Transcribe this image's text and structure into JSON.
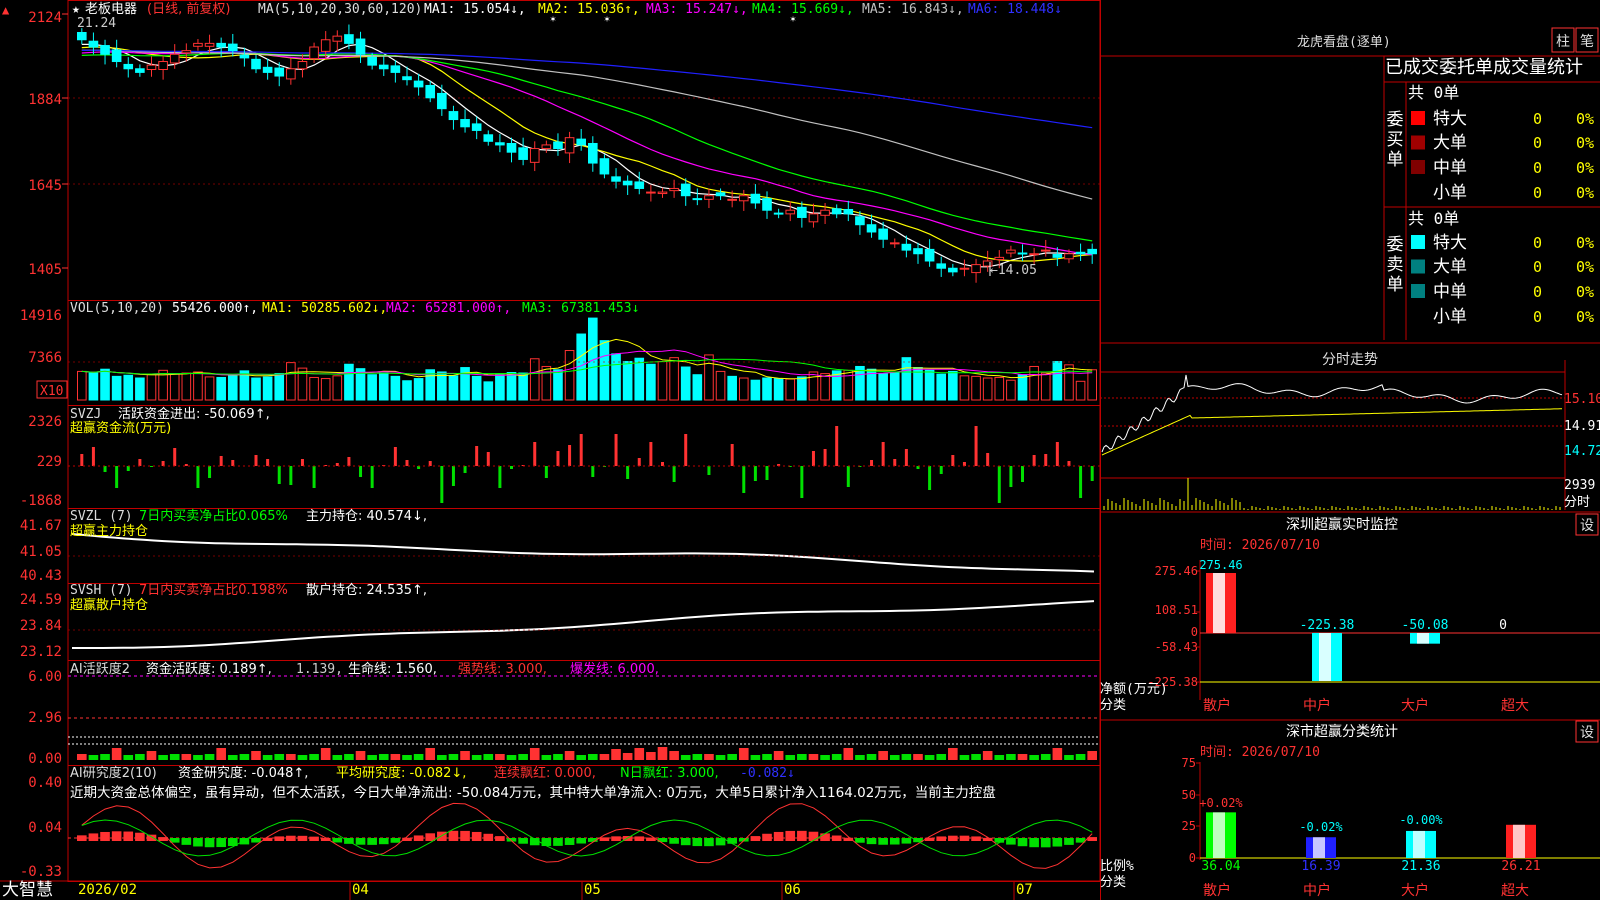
{
  "app": {
    "brand": "大智慧",
    "chip": "▲"
  },
  "colors": {
    "up": "#ff3232",
    "down": "#00ffff",
    "grid": "#c00000",
    "axis": "#ff3232",
    "ma1": "#ffffff",
    "ma2": "#ffff00",
    "ma3": "#ff00ff",
    "ma4": "#00ff00",
    "ma5": "#c0c0c0",
    "ma6": "#2020ff"
  },
  "price_header": {
    "star": "★",
    "name": "老板电器",
    "mode": "(日线, 前复权)",
    "ma_def": "MA(5,10,20,30,60,120)",
    "ma1": "MA1: 15.054↓,",
    "ma2": "MA2: 15.036↑,",
    "ma3": "MA3: 15.247↓,",
    "ma4": "MA4: 15.669↓,",
    "ma5": "MA5: 16.843↓,",
    "ma6": "MA6: 18.448↓",
    "hi_label": "21.24",
    "lo_label": "←14.05"
  },
  "vol_header": {
    "title": "VOL(5,10,20)",
    "value": "55426.000↑,",
    "ma1": "MA1: 50285.602↓,",
    "ma2": "MA2: 65281.000↑,",
    "ma3": "MA3: 67381.453↓",
    "unit": "X10"
  },
  "svzj_header": {
    "title": "SVZJ",
    "label": "活跃资金进出: -50.069↑,",
    "sub": "超赢资金流(万元)"
  },
  "svzl_header": {
    "title": "SVZL (7)",
    "label": "7日内买卖净占比0.065%",
    "label2": "主力持仓: 40.574↓,",
    "sub": "超赢主力持仓"
  },
  "svsh_header": {
    "title": "SVSH (7)",
    "label": "7日内买卖净占比0.198%",
    "label2": "散户持仓: 24.535↑,",
    "sub": "超赢散户持仓"
  },
  "ai1_header": {
    "title": "AI活跃度2",
    "l1": "资金活跃度: 0.189↑,",
    "l2": "1.139,",
    "l3": "生命线: 1.560,",
    "l4": "强势线: 3.000,",
    "l5": "爆发线: 6.000,"
  },
  "ai2_header": {
    "title": "AI研究度2(10)",
    "l1": "资金研究度: -0.048↑,",
    "l2": "平均研究度: -0.082↓,",
    "l3": "连续飘红: 0.000,",
    "l4": "N日飘红: 3.000,",
    "l5": "-0.082↓"
  },
  "ai2_comment": "近期大资金总体偏空，虽有异动，但不太活跃，今日大单净流出: -50.084万元，其中特大单净流入: 0万元，大单5日累计净入1164.02万元，当前主力控盘",
  "axis_labels": {
    "price": [
      "2124",
      "1884",
      "1645",
      "1405"
    ],
    "vol": [
      "14916",
      "7366"
    ],
    "svzj": [
      "2326",
      "229",
      "-1868"
    ],
    "svzl": [
      "41.67",
      "41.05",
      "40.43"
    ],
    "svsh": [
      "24.59",
      "23.84",
      "23.12"
    ],
    "ai1": [
      "6.00",
      "2.96",
      "0.00"
    ],
    "ai2": [
      "0.40",
      "0.04",
      "-0.33"
    ]
  },
  "date_axis": [
    "2026/02",
    "04",
    "05",
    "06",
    "07"
  ],
  "dragon": {
    "title": "龙虎看盘(逐单)",
    "btn1": "柱",
    "btn2": "笔",
    "head": "已成交委托单成交量统计",
    "buy": "委买单",
    "sell": "委卖单",
    "buy_total": "共 0单",
    "sell_total": "共 0单",
    "buy_rows": [
      {
        "name": "特大",
        "n": "0",
        "p": "0%"
      },
      {
        "name": "大单",
        "n": "0",
        "p": "0%"
      },
      {
        "name": "中单",
        "n": "0",
        "p": "0%"
      },
      {
        "name": "小单",
        "n": "0",
        "p": "0%"
      }
    ],
    "sell_rows": [
      {
        "name": "特大",
        "n": "0",
        "p": "0%"
      },
      {
        "name": "大单",
        "n": "0",
        "p": "0%"
      },
      {
        "name": "中单",
        "n": "0",
        "p": "0%"
      },
      {
        "name": "小单",
        "n": "0",
        "p": "0%"
      }
    ]
  },
  "intraday": {
    "title": "分时走势",
    "p1": "15.10",
    "p2": "14.91",
    "p3": "14.72",
    "v1": "2939",
    "v2": "分时"
  },
  "sz_monitor": {
    "title": "深圳超赢实时监控",
    "btn": "设",
    "time": "时间: 2026/07/10",
    "yticks": [
      "275.46",
      "108.51",
      "0",
      "-58.43",
      "-225.38"
    ],
    "ylabel1": "净额(万元)",
    "ylabel2": "分类",
    "vals": [
      "275.46",
      "-225.38",
      "-50.08",
      "0"
    ],
    "cats": [
      "散户",
      "中户",
      "大户",
      "超大"
    ]
  },
  "sz_class": {
    "title": "深市超赢分类统计",
    "btn": "设",
    "time": "时间: 2026/07/10",
    "yticks": [
      "75",
      "50",
      "25",
      "0"
    ],
    "ylabel1": "比例%",
    "ylabel2": "分类",
    "pct": [
      "+0.02%",
      "-0.02%",
      "-0.00%",
      ""
    ],
    "vals": [
      "36.04",
      "16.39",
      "21.36",
      "26.21"
    ],
    "cats": [
      "散户",
      "中户",
      "大户",
      "超大"
    ]
  },
  "chart_data": [
    {
      "type": "candlestick",
      "title": "老板电器",
      "ylim": [
        14.0,
        21.5
      ],
      "x": [
        "2026/02",
        "04",
        "05",
        "06",
        "07"
      ],
      "series": [
        {
          "name": "MA1",
          "values": [
            15.054
          ]
        },
        {
          "name": "MA2",
          "values": [
            15.036
          ]
        },
        {
          "name": "MA3",
          "values": [
            15.247
          ]
        },
        {
          "name": "MA4",
          "values": [
            15.669
          ]
        },
        {
          "name": "MA5",
          "values": [
            16.843
          ]
        },
        {
          "name": "MA6",
          "values": [
            18.448
          ]
        }
      ],
      "close": [
        20.9,
        20.7,
        20.5,
        20.3,
        20.1,
        20.0,
        20.2,
        20.3,
        20.5,
        20.6,
        20.8,
        20.8,
        20.7,
        20.6,
        20.4,
        20.1,
        20.0,
        19.9,
        20.1,
        20.3,
        20.7,
        20.9,
        21.0,
        20.8,
        20.5,
        20.2,
        20.1,
        20.0,
        19.8,
        19.6,
        19.3,
        19.0,
        18.7,
        18.5,
        18.4,
        18.1,
        18.0,
        17.8,
        17.6,
        17.9,
        18.0,
        17.9,
        18.2,
        18.0,
        17.5,
        17.2,
        17.0,
        16.9,
        16.8,
        16.7,
        16.7,
        16.8,
        16.6,
        16.5,
        16.6,
        16.6,
        16.5,
        16.6,
        16.4,
        16.2,
        16.1,
        16.2,
        16.0,
        16.1,
        16.2,
        16.1,
        16.1,
        15.8,
        15.6,
        15.4,
        15.3,
        15.1,
        15.0,
        14.8,
        14.6,
        14.5,
        14.6,
        14.7,
        14.8,
        14.9,
        15.1,
        15.0,
        15.0,
        15.1,
        14.9,
        15.0,
        15.0,
        15.0
      ]
    },
    {
      "type": "bar",
      "title": "VOL(5,10,20)",
      "ylim": [
        0,
        14916
      ],
      "series": [
        {
          "name": "MA1",
          "values": [
            50285.602
          ]
        },
        {
          "name": "MA2",
          "values": [
            65281.0
          ]
        },
        {
          "name": "MA3",
          "values": [
            67381.453
          ]
        }
      ],
      "values": [
        5.2,
        4.9,
        5.6,
        4.3,
        4.5,
        4.0,
        4.6,
        5.4,
        4.8,
        4.9,
        5.1,
        4.2,
        4.1,
        4.4,
        5.3,
        4.0,
        4.2,
        4.8,
        6.8,
        5.8,
        4.1,
        3.9,
        4.4,
        6.5,
        5.7,
        4.6,
        4.9,
        4.3,
        3.5,
        3.9,
        5.5,
        5.1,
        4.4,
        5.9,
        4.3,
        3.3,
        4.6,
        5.0,
        4.9,
        7.5,
        6.1,
        5.5,
        9.0,
        12.0,
        14.9,
        10.8,
        8.4,
        7.0,
        7.6,
        6.5,
        7.0,
        7.7,
        6.0,
        4.6,
        8.2,
        5.2,
        4.3,
        4.0,
        3.6,
        4.0,
        3.9,
        3.8,
        4.2,
        5.1,
        4.8,
        5.3,
        5.4,
        6.1,
        5.6,
        4.8,
        5.1,
        7.7,
        5.9,
        5.4,
        4.7,
        5.2,
        4.4,
        4.3,
        4.0,
        4.1,
        3.6,
        4.6,
        6.1,
        4.9,
        7.0,
        6.4,
        3.4,
        5.5
      ]
    },
    {
      "type": "bar",
      "title": "SVZJ",
      "ylim": [
        -1868,
        2326
      ],
      "label": "活跃资金进出: -50.069"
    },
    {
      "type": "line",
      "title": "SVZL (7)",
      "ylim": [
        40.43,
        41.67
      ],
      "series": [
        {
          "name": "主力持仓",
          "values": [
            40.574
          ]
        }
      ]
    },
    {
      "type": "line",
      "title": "SVSH (7)",
      "ylim": [
        23.12,
        24.59
      ],
      "series": [
        {
          "name": "散户持仓",
          "values": [
            24.535
          ]
        }
      ]
    },
    {
      "type": "bar",
      "title": "AI活跃度2",
      "ylim": [
        0,
        6.0
      ],
      "series": [
        {
          "name": "资金活跃度",
          "values": [
            0.189
          ]
        },
        {
          "name": "生命线",
          "values": [
            1.56
          ]
        },
        {
          "name": "强势线",
          "values": [
            3.0
          ]
        },
        {
          "name": "爆发线",
          "values": [
            6.0
          ]
        }
      ]
    },
    {
      "type": "line",
      "title": "AI研究度2(10)",
      "ylim": [
        -0.33,
        0.4
      ],
      "series": [
        {
          "name": "资金研究度",
          "values": [
            -0.048
          ]
        },
        {
          "name": "平均研究度",
          "values": [
            -0.082
          ]
        }
      ]
    },
    {
      "type": "bar",
      "title": "深圳超赢实时监控",
      "categories": [
        "散户",
        "中户",
        "大户",
        "超大"
      ],
      "values": [
        275.46,
        -225.38,
        -50.08,
        0
      ],
      "ylim": [
        -225.38,
        275.46
      ],
      "ylabel": "净额(万元)",
      "xlabel": "分类"
    },
    {
      "type": "bar",
      "title": "深市超赢分类统计",
      "categories": [
        "散户",
        "中户",
        "大户",
        "超大"
      ],
      "values": [
        36.04,
        16.39,
        21.36,
        26.21
      ],
      "ylim": [
        0,
        75
      ],
      "ylabel": "比例%",
      "xlabel": "分类"
    }
  ]
}
